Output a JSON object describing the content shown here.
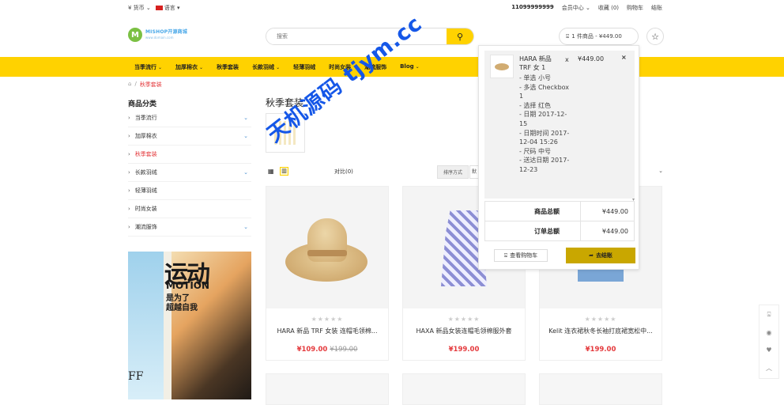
{
  "topbar": {
    "currency": "¥ 货币 ⌄",
    "language": "语言 ▾",
    "phone": "11099999999",
    "member": "会员中心 ⌄",
    "favorites": "收藏 (0)",
    "cart": "购物车",
    "checkout": "结账"
  },
  "logo": {
    "mark": "M",
    "name": "MISHOP开源商城",
    "url": "www.domain.com"
  },
  "search": {
    "placeholder": "搜索"
  },
  "header": {
    "cart_summary": "1 件商品 - ¥449.00"
  },
  "nav": [
    {
      "label": "当季流行",
      "caret": "⌄"
    },
    {
      "label": "加厚棉衣",
      "caret": "⌄"
    },
    {
      "label": "秋季套装",
      "caret": ""
    },
    {
      "label": "长款羽绒",
      "caret": "⌄"
    },
    {
      "label": "轻薄羽绒",
      "caret": ""
    },
    {
      "label": "时尚女装",
      "caret": ""
    },
    {
      "label": "潮流服饰",
      "caret": ""
    },
    {
      "label": "Blog",
      "caret": "⌄"
    }
  ],
  "breadcrumb": {
    "home_icon": "home-icon",
    "separator": "/",
    "current": "秋季套装"
  },
  "sidebar": {
    "title": "商品分类",
    "categories": [
      {
        "label": "当季流行",
        "has_children": true
      },
      {
        "label": "加厚棉衣",
        "has_children": true
      },
      {
        "label": "秋季套装",
        "has_children": false,
        "active": true
      },
      {
        "label": "长款羽绒",
        "has_children": true
      },
      {
        "label": "轻薄羽绒",
        "has_children": false
      },
      {
        "label": "时尚女装",
        "has_children": false
      },
      {
        "label": "潮流服饰",
        "has_children": true
      }
    ],
    "banner": {
      "t1": "运动",
      "t2": "MOTION",
      "t3": "是为了",
      "t4": "超越自我",
      "t5": "FF"
    }
  },
  "main": {
    "title": "秋季套装",
    "compare": "对比(0)",
    "sort_label": "排序方式",
    "sort_value": "默"
  },
  "products": [
    {
      "name": "HARA 新品 TRF 女装 连帽毛领棉...",
      "price": "¥109.00",
      "old_price": "¥199.00",
      "stars": "★★★★★"
    },
    {
      "name": "HAXA 新品女装连帽毛领棉服外套",
      "price": "¥199.00",
      "old_price": "",
      "stars": "★★★★★"
    },
    {
      "name": "Kelit 连衣裙秋冬长袖打底裙宽松中...",
      "price": "¥199.00",
      "old_price": "",
      "stars": "★★★★★"
    }
  ],
  "cart_popup": {
    "item": {
      "name": "HARA 新品 TRF 女 1",
      "qty": "x",
      "price": "¥449.00",
      "remove": "×",
      "options": [
        "- 单选 小号",
        "- 多选 Checkbox 1",
        "- 选择 红色",
        "- 日期 2017-12-15",
        "- 日期时间 2017-12-04 15:26",
        "- 尺码 中号",
        "- 送达日期 2017-12-23"
      ]
    },
    "scroll_indicator": "▾",
    "subtotal_label": "商品总额",
    "subtotal_value": "¥449.00",
    "total_label": "订单总额",
    "total_value": "¥449.00",
    "view_cart": "查看购物车",
    "checkout": "去结账"
  },
  "floatbar": [
    "cart-icon",
    "user-icon",
    "heart-icon",
    "up-icon"
  ],
  "watermark": "天机源码 tjym.cc"
}
